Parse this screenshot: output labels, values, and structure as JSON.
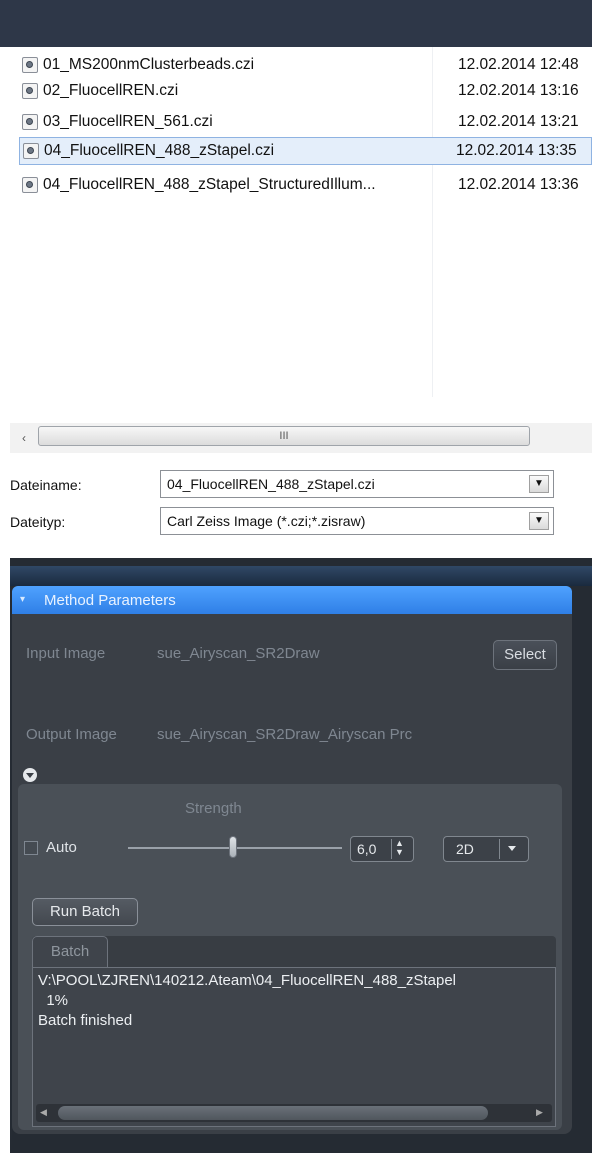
{
  "files": [
    {
      "name": "01_MS200nmClusterbeads.czi",
      "date": "12.02.2014 12:48",
      "selected": false
    },
    {
      "name": "02_FluocellREN.czi",
      "date": "12.02.2014 13:16",
      "selected": false
    },
    {
      "name": "03_FluocellREN_561.czi",
      "date": "12.02.2014 13:21",
      "selected": false
    },
    {
      "name": "04_FluocellREN_488_zStapel.czi",
      "date": "12.02.2014 13:35",
      "selected": true
    },
    {
      "name": "04_FluocellREN_488_zStapel_StructuredIllum...",
      "date": "12.02.2014 13:36",
      "selected": false
    }
  ],
  "hscroll": {
    "grip": "III",
    "left_arrow": "‹"
  },
  "dialog": {
    "filename_label": "Dateiname:",
    "filename_value": "04_FluocellREN_488_zStapel.czi",
    "filetype_label": "Dateityp:",
    "filetype_value": "Carl Zeiss Image (*.czi;*.zisraw)",
    "combo_arrow": "▼"
  },
  "panel": {
    "header": "Method Parameters",
    "input_label": "Input Image",
    "input_value": "sue_Airyscan_SR2Draw",
    "select_label": "Select",
    "output_label": "Output Image",
    "output_value": "sue_Airyscan_SR2Draw_Airyscan Prc",
    "strength_label": "Strength",
    "auto_label": "Auto",
    "auto_checked": false,
    "strength_value": "6,0",
    "strength_level": 6.0,
    "spin_arrows": "▲\n▼",
    "mode_value": "2D",
    "run_batch_label": "Run Batch",
    "batch_tab_label": "Batch",
    "console_lines": [
      "V:\\POOL\\ZJREN\\140212.Ateam\\04_FluocellREN_488_zStapel",
      "  1%",
      "Batch finished"
    ]
  },
  "colors": {
    "selection_bg": "#e4eefa",
    "header_blue": "#3a8ef5",
    "panel_bg": "#3a3f46"
  }
}
